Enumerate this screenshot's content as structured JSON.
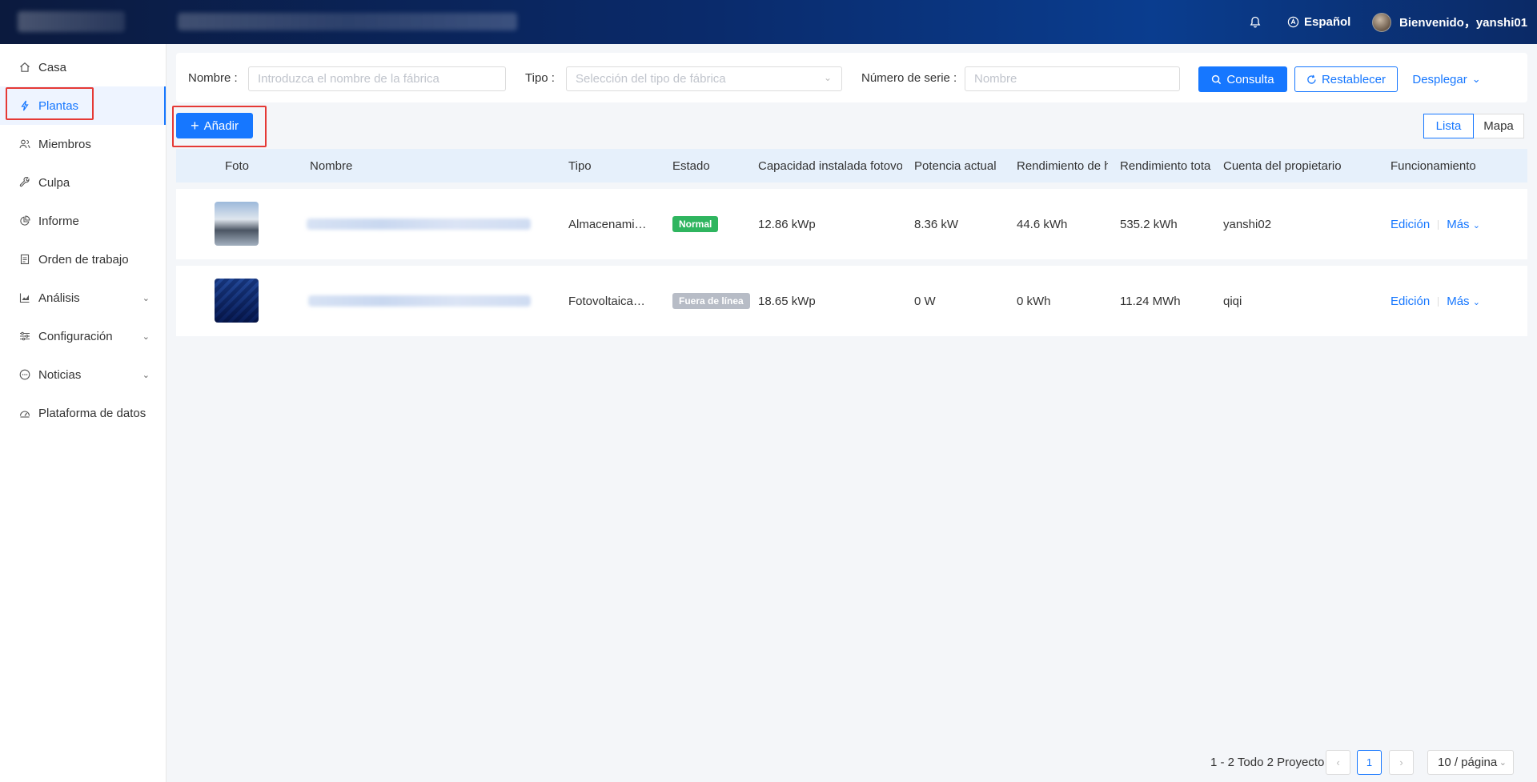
{
  "header": {
    "language": "Español",
    "welcome": "Bienvenido，yanshi01"
  },
  "sidebar": {
    "items": [
      {
        "label": "Casa",
        "icon": "home-icon"
      },
      {
        "label": "Plantas",
        "icon": "bolt-icon",
        "active": true
      },
      {
        "label": "Miembros",
        "icon": "users-icon"
      },
      {
        "label": "Culpa",
        "icon": "wrench-icon"
      },
      {
        "label": "Informe",
        "icon": "pie-icon"
      },
      {
        "label": "Orden de trabajo",
        "icon": "clipboard-icon"
      },
      {
        "label": "Análisis",
        "icon": "chart-icon",
        "expandable": true
      },
      {
        "label": "Configuración",
        "icon": "sliders-icon",
        "expandable": true
      },
      {
        "label": "Noticias",
        "icon": "message-icon",
        "expandable": true
      },
      {
        "label": "Plataforma de datos",
        "icon": "dashboard-icon"
      }
    ]
  },
  "filter": {
    "name_label": "Nombre",
    "name_placeholder": "Introduzca el nombre de la fábrica",
    "type_label": "Tipo",
    "type_placeholder": "Selección del tipo de fábrica",
    "serial_label": "Número de serie",
    "serial_placeholder": "Nombre",
    "query_button": "Consulta",
    "reset_button": "Restablecer",
    "expand_link": "Desplegar"
  },
  "toolbar": {
    "add_button": "Añadir",
    "view_list": "Lista",
    "view_map": "Mapa"
  },
  "table": {
    "columns": [
      "Foto",
      "Nombre",
      "Tipo",
      "Estado",
      "Capacidad instalada fotovo",
      "Potencia actual",
      "Rendimiento de h",
      "Rendimiento tota",
      "Cuenta del propietario",
      "Funcionamiento"
    ],
    "rows": [
      {
        "type": "Almacenami…",
        "status": "Normal",
        "capacity": "12.86 kWp",
        "power": "8.36 kW",
        "daily": "44.6 kWh",
        "total": "535.2 kWh",
        "owner": "yanshi02",
        "edit": "Edición",
        "more": "Más"
      },
      {
        "type": "Fotovoltaica…",
        "status": "Fuera de línea",
        "capacity": "18.65 kWp",
        "power": "0 W",
        "daily": "0 kWh",
        "total": "11.24 MWh",
        "owner": "qiqi",
        "edit": "Edición",
        "more": "Más"
      }
    ]
  },
  "pagination": {
    "summary": "1 - 2 Todo 2 Proyecto",
    "current_page": "1",
    "page_size": "10 / página"
  },
  "colors": {
    "primary": "#1677ff",
    "normal": "#2fb55f",
    "offline": "#b7bcc6",
    "highlight": "#e53935"
  }
}
